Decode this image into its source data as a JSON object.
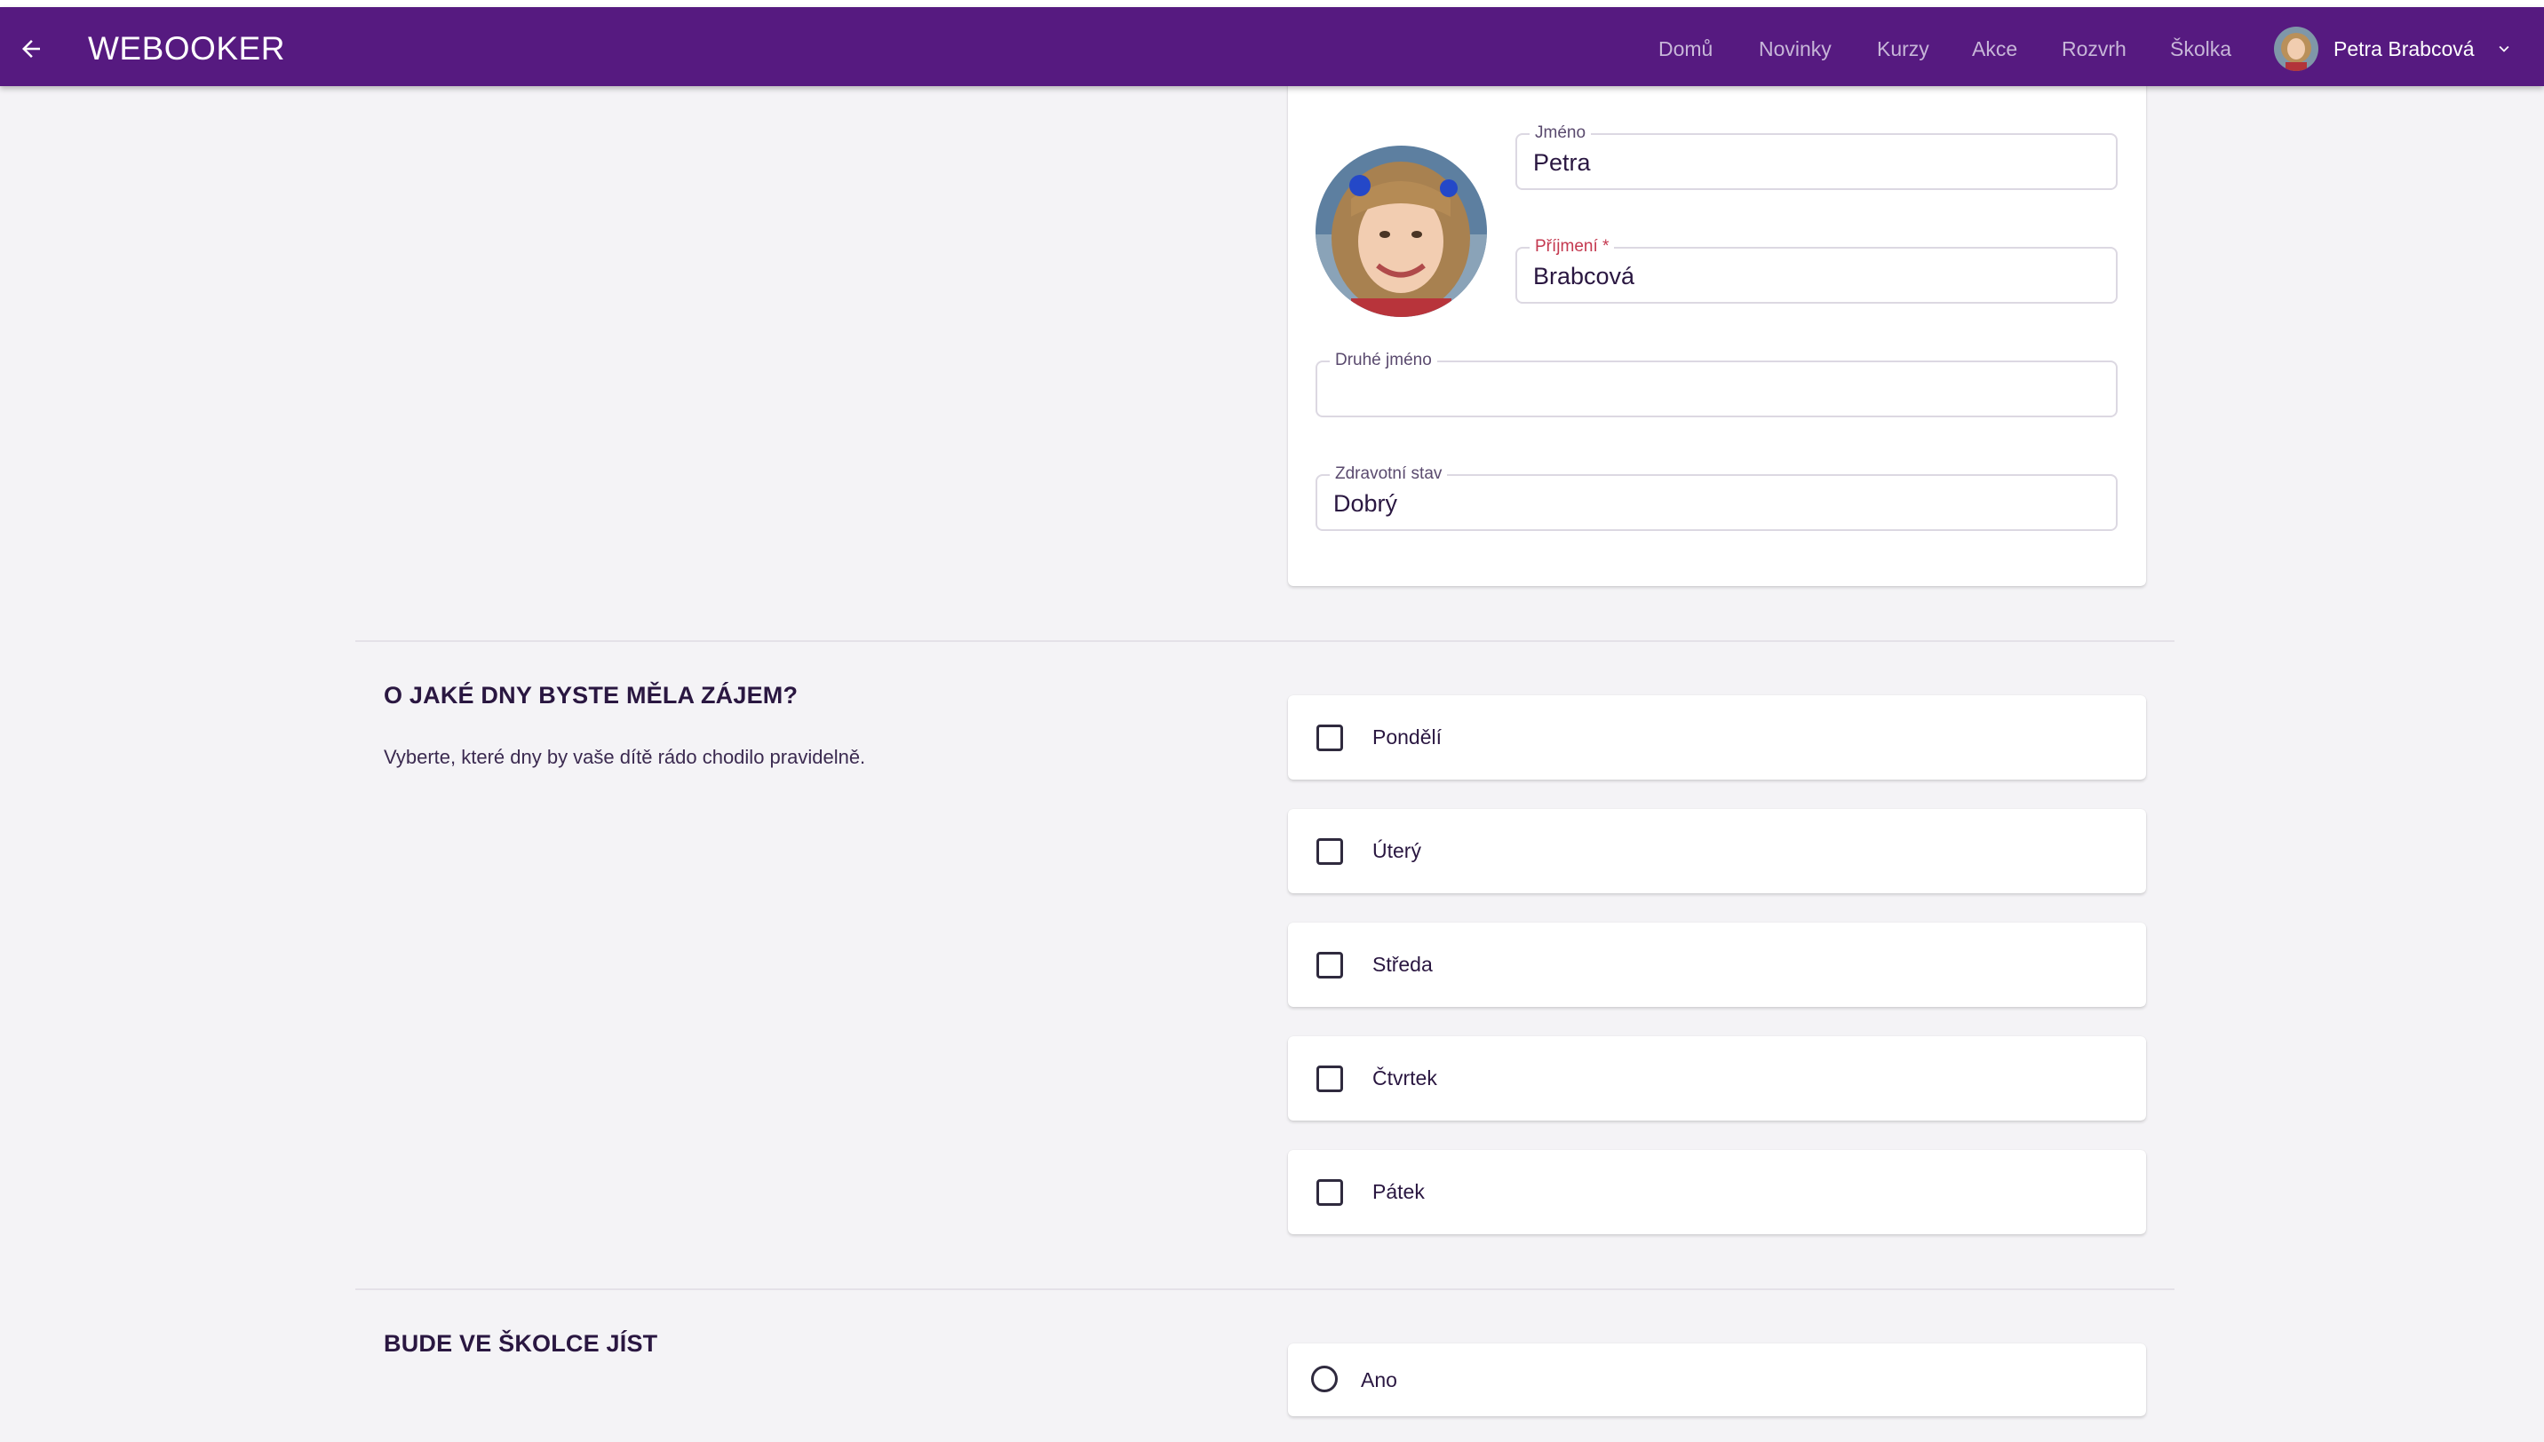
{
  "app": {
    "brand": "WEBOOKER"
  },
  "nav": {
    "items": [
      {
        "label": "Domů"
      },
      {
        "label": "Novinky"
      },
      {
        "label": "Kurzy"
      },
      {
        "label": "Akce"
      },
      {
        "label": "Rozvrh"
      },
      {
        "label": "Školka"
      }
    ],
    "user_name": "Petra Brabcová"
  },
  "profile": {
    "first_name_label": "Jméno",
    "first_name_value": "Petra",
    "last_name_label": "Příjmení *",
    "last_name_value": "Brabcová",
    "middle_name_label": "Druhé jméno",
    "middle_name_value": "",
    "health_label": "Zdravotní stav",
    "health_value": "Dobrý"
  },
  "days_section": {
    "title": "O JAKÉ DNY BYSTE MĚLA ZÁJEM?",
    "description": "Vyberte, které dny by vaše dítě rádo chodilo pravidelně.",
    "options": [
      {
        "label": "Pondělí",
        "checked": false
      },
      {
        "label": "Úterý",
        "checked": false
      },
      {
        "label": "Středa",
        "checked": false
      },
      {
        "label": "Čtvrtek",
        "checked": false
      },
      {
        "label": "Pátek",
        "checked": false
      }
    ]
  },
  "meals_section": {
    "title": "BUDE VE ŠKOLCE JÍST",
    "options": [
      {
        "label": "Ano",
        "selected": false
      }
    ]
  },
  "colors": {
    "appbar": "#561a80",
    "required": "#c4384f",
    "background": "#f4f3f6"
  },
  "icons": [
    "arrow-left-icon",
    "chevron-down-icon"
  ]
}
